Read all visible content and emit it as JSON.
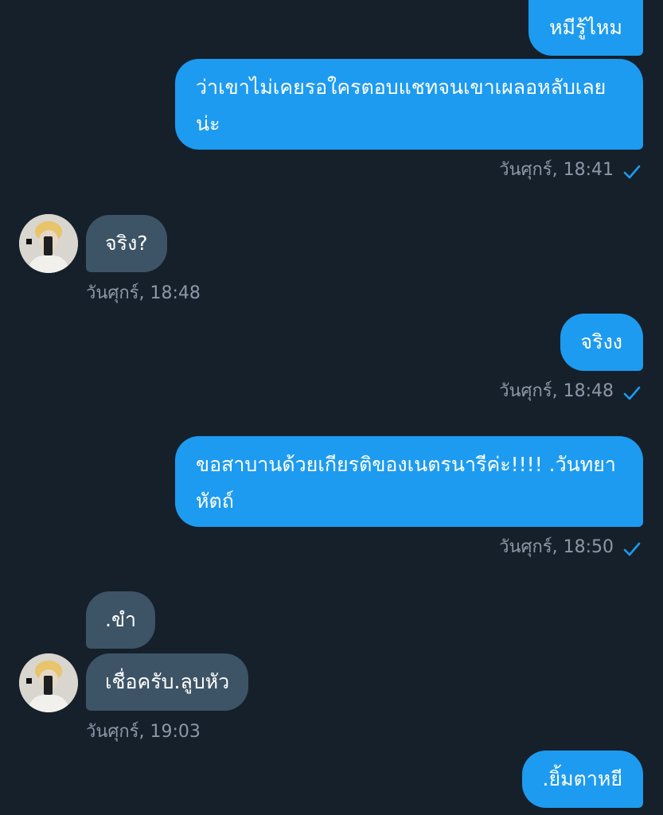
{
  "conversation": {
    "messages": [
      {
        "text": "หมีรู้ไหม"
      },
      {
        "text": "ว่าเขาไม่เคยรอใครตอบแชทจนเขาเผลอหลับเลยน่ะ",
        "timestamp": "วันศุกร์, 18:41"
      },
      {
        "text": "จริง?",
        "timestamp": "วันศุกร์, 18:48"
      },
      {
        "text": "จริงง",
        "timestamp": "วันศุกร์, 18:48"
      },
      {
        "text": "ขอสาบานด้วยเกียรติของเนตรนารีค่ะ!!!! .วันทยาหัตถ์",
        "timestamp": "วันศุกร์, 18:50"
      },
      {
        "text": ".ขำ"
      },
      {
        "text": "เชื่อครับ.ลูบหัว",
        "timestamp": "วันศุกร์, 19:03"
      },
      {
        "text": ".ยิ้มตาหยี"
      }
    ]
  },
  "colors": {
    "background": "#15202b",
    "sent_bubble": "#1d9bf0",
    "received_bubble": "#3d5466",
    "timestamp": "#8b98a5",
    "read_check": "#1d9bf0"
  },
  "icons": {
    "read_receipt": "checkmark-icon",
    "contact_avatar": "avatar"
  }
}
